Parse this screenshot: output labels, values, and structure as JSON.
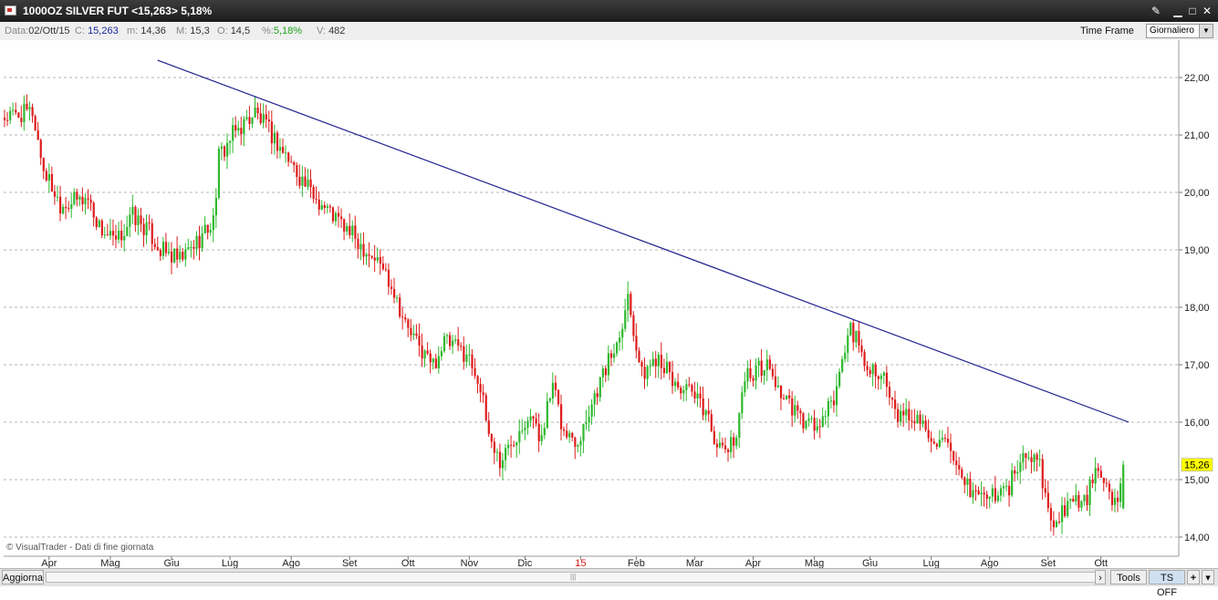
{
  "window": {
    "title": "1000OZ SILVER FUT <15,263> 5,18%",
    "controls": [
      "tool-icon",
      "minimize-icon",
      "maximize-icon",
      "close-icon"
    ]
  },
  "info": {
    "date_label": "Data:",
    "date_value": "02/Ott/15",
    "close_label": "C:",
    "close_value": "15,263",
    "min_label": "m:",
    "min_value": "14,36",
    "max_label": "M:",
    "max_value": "15,3",
    "open_label": "O:",
    "open_value": "14,5",
    "pct_label": "%:",
    "pct_value": "5,18%",
    "vol_label": "V:",
    "vol_value": "482",
    "timeframe_label": "Time Frame",
    "timeframe_value": "Giornaliero"
  },
  "bottom": {
    "refresh_label": "Aggiorna",
    "tools_label": "Tools",
    "ts_label": "TS OFF",
    "plus_label": "+"
  },
  "colors": {
    "up": "#2eb82e",
    "down": "#dd1c1c",
    "trendline": "#1f1f8f",
    "price_tag": "#ffff00"
  },
  "chart_data": {
    "type": "candlestick",
    "watermark": "© VisualTrader - Dati di fine giornata",
    "last_price_label": "15,26",
    "last_price": 15.26,
    "ylim": [
      13.8,
      22.6
    ],
    "y_ticks": [
      14,
      15,
      16,
      17,
      18,
      19,
      20,
      21,
      22
    ],
    "y_tick_labels": [
      "14,00",
      "15,00",
      "16,00",
      "17,00",
      "18,00",
      "19,00",
      "20,00",
      "21,00",
      "22,00"
    ],
    "grid": "horizontal dashed",
    "x_labels": [
      "Apr",
      "Mag",
      "Giu",
      "Lug",
      "Ago",
      "Set",
      "Ott",
      "Nov",
      "Dic",
      "15",
      "Feb",
      "Mar",
      "Apr",
      "Mag",
      "Giu",
      "Lug",
      "Ago",
      "Set",
      "Ott"
    ],
    "x_label_index": [
      16,
      38,
      60,
      81,
      103,
      124,
      145,
      167,
      187,
      207,
      227,
      248,
      269,
      291,
      311,
      333,
      354,
      375,
      394
    ],
    "year_marker_label": "15",
    "trendline": {
      "from": {
        "index": 55,
        "price": 22.3
      },
      "to": {
        "index": 404,
        "price": 16.0
      }
    },
    "anchors": [
      [
        0,
        21.3
      ],
      [
        10,
        21.4
      ],
      [
        14,
        20.4
      ],
      [
        20,
        19.8
      ],
      [
        30,
        19.9
      ],
      [
        34,
        19.4
      ],
      [
        40,
        19.1
      ],
      [
        46,
        19.6
      ],
      [
        52,
        19.3
      ],
      [
        56,
        19.0
      ],
      [
        63,
        18.8
      ],
      [
        70,
        19.2
      ],
      [
        75,
        19.5
      ],
      [
        77,
        20.6
      ],
      [
        82,
        21.0
      ],
      [
        90,
        21.4
      ],
      [
        96,
        21.0
      ],
      [
        103,
        20.5
      ],
      [
        110,
        20.0
      ],
      [
        118,
        19.6
      ],
      [
        124,
        19.3
      ],
      [
        130,
        19.0
      ],
      [
        136,
        18.7
      ],
      [
        140,
        18.3
      ],
      [
        144,
        17.7
      ],
      [
        149,
        17.3
      ],
      [
        154,
        17.0
      ],
      [
        158,
        17.4
      ],
      [
        166,
        17.2
      ],
      [
        170,
        16.8
      ],
      [
        174,
        15.8
      ],
      [
        178,
        15.3
      ],
      [
        186,
        16.0
      ],
      [
        189,
        16.2
      ],
      [
        192,
        15.7
      ],
      [
        197,
        16.6
      ],
      [
        201,
        15.8
      ],
      [
        206,
        15.7
      ],
      [
        213,
        16.6
      ],
      [
        220,
        17.4
      ],
      [
        224,
        18.2
      ],
      [
        229,
        16.8
      ],
      [
        235,
        17.2
      ],
      [
        240,
        16.7
      ],
      [
        246,
        16.5
      ],
      [
        252,
        16.2
      ],
      [
        257,
        15.5
      ],
      [
        262,
        15.6
      ],
      [
        266,
        16.8
      ],
      [
        274,
        17.0
      ],
      [
        280,
        16.4
      ],
      [
        287,
        16.0
      ],
      [
        293,
        15.9
      ],
      [
        298,
        16.4
      ],
      [
        304,
        17.7
      ],
      [
        309,
        17.0
      ],
      [
        315,
        16.9
      ],
      [
        320,
        16.1
      ],
      [
        327,
        16.1
      ],
      [
        333,
        15.8
      ],
      [
        339,
        15.5
      ],
      [
        344,
        14.9
      ],
      [
        352,
        14.7
      ],
      [
        360,
        14.8
      ],
      [
        366,
        15.4
      ],
      [
        372,
        15.3
      ],
      [
        376,
        14.2
      ],
      [
        382,
        14.6
      ],
      [
        388,
        14.6
      ],
      [
        392,
        15.1
      ],
      [
        396,
        14.8
      ],
      [
        400,
        14.55
      ],
      [
        402,
        15.26
      ]
    ]
  }
}
